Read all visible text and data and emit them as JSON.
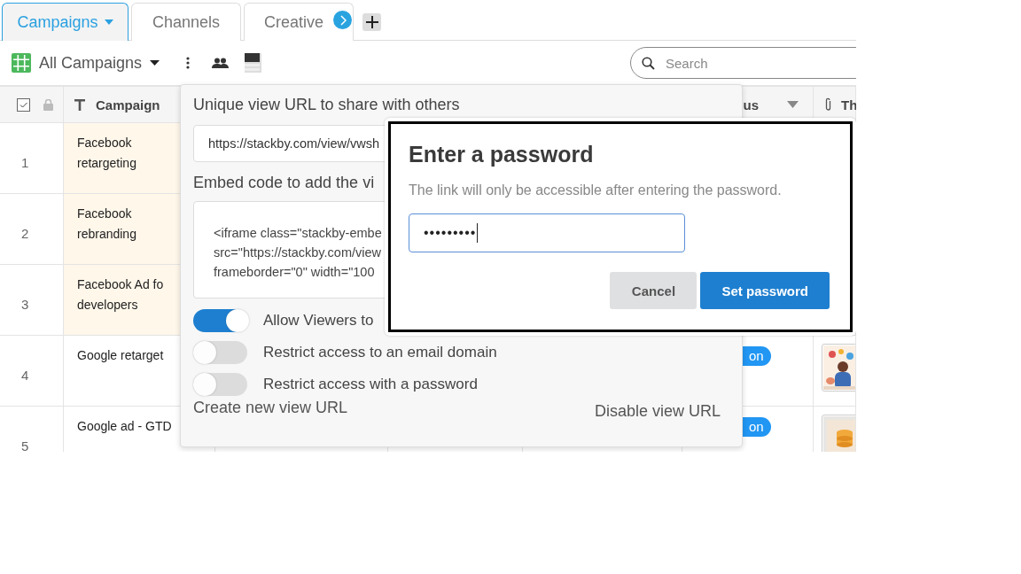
{
  "tabs": [
    {
      "label": "Campaigns",
      "selected": true
    },
    {
      "label": "Channels",
      "selected": false
    },
    {
      "label": "Creative",
      "selected": false
    }
  ],
  "toolbar": {
    "view_name": "All Campaigns",
    "search": {
      "placeholder": "Search"
    }
  },
  "table": {
    "columns": [
      {
        "label": "Campaign"
      },
      {
        "label": "us"
      },
      {
        "label": "Th"
      }
    ],
    "rows": [
      {
        "number": "1",
        "campaign": "Facebook retargeting",
        "highlighted": true
      },
      {
        "number": "2",
        "campaign": "Facebook rebranding",
        "highlighted": true
      },
      {
        "number": "3",
        "campaign": "Facebook Ad fo developers",
        "highlighted": true
      },
      {
        "number": "4",
        "campaign": "Google retarget",
        "highlighted": false,
        "status": "on"
      },
      {
        "number": "5",
        "campaign": "Google ad - GTD",
        "highlighted": false,
        "status": "on"
      }
    ]
  },
  "share": {
    "url_label": "Unique view URL to share with others",
    "url": "https://stackby.com/view/vwsh",
    "embed_label": "Embed code to add the vi",
    "embed_code": "<iframe class=\"stackby-embe\nsrc=\"https://stackby.com/view\nframeborder=\"0\" width=\"100",
    "toggles": [
      {
        "label": "Allow Viewers to",
        "on": true
      },
      {
        "label": "Restrict access to an email domain",
        "on": false
      },
      {
        "label": "Restrict access with a password",
        "on": false
      }
    ],
    "create_link": "Create new view URL",
    "disable_link": "Disable view URL"
  },
  "dialog": {
    "title": "Enter a password",
    "description": "The link will only be accessible after entering the password.",
    "password": "•••••••••",
    "buttons": [
      {
        "label": "Cancel",
        "kind": "secondary"
      },
      {
        "label": "Set password",
        "kind": "primary"
      }
    ]
  }
}
